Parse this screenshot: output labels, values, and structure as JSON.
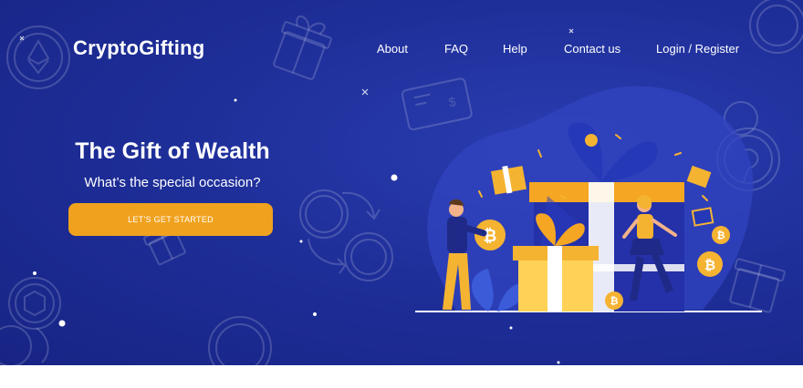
{
  "brand": {
    "name": "CryptoGifting"
  },
  "nav": {
    "items": [
      {
        "label": "About"
      },
      {
        "label": "FAQ"
      },
      {
        "label": "Help"
      },
      {
        "label": "Contact us"
      },
      {
        "label": "Login / Register"
      }
    ]
  },
  "hero": {
    "headline": "The Gift of Wealth",
    "subheadline": "What’s the special occasion?",
    "cta_label": "LET'S GET STARTED",
    "coin_symbol": "₿"
  },
  "colors": {
    "background": "#1f2f9a",
    "accent": "#f0a21f",
    "text": "#ffffff",
    "coin": "#f5b332",
    "box_blue": "#2431a8",
    "box_yellow": "#ffd257"
  },
  "icons": [
    "ethereum-coin-icon",
    "gift-icon",
    "gift-card-icon",
    "dollar-exchange-icon",
    "bitcoin-coin-icon",
    "polkadot-coin-icon",
    "chainlink-coin-icon",
    "cardano-coin-icon"
  ]
}
